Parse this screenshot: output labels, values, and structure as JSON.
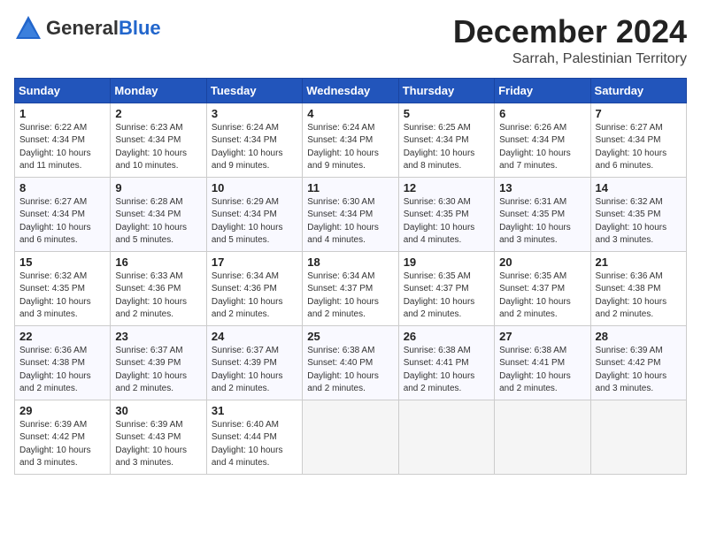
{
  "logo": {
    "general": "General",
    "blue": "Blue"
  },
  "title": "December 2024",
  "location": "Sarrah, Palestinian Territory",
  "days_of_week": [
    "Sunday",
    "Monday",
    "Tuesday",
    "Wednesday",
    "Thursday",
    "Friday",
    "Saturday"
  ],
  "weeks": [
    [
      {
        "day": "1",
        "sunrise": "6:22 AM",
        "sunset": "4:34 PM",
        "daylight": "10 hours and 11 minutes."
      },
      {
        "day": "2",
        "sunrise": "6:23 AM",
        "sunset": "4:34 PM",
        "daylight": "10 hours and 10 minutes."
      },
      {
        "day": "3",
        "sunrise": "6:24 AM",
        "sunset": "4:34 PM",
        "daylight": "10 hours and 9 minutes."
      },
      {
        "day": "4",
        "sunrise": "6:24 AM",
        "sunset": "4:34 PM",
        "daylight": "10 hours and 9 minutes."
      },
      {
        "day": "5",
        "sunrise": "6:25 AM",
        "sunset": "4:34 PM",
        "daylight": "10 hours and 8 minutes."
      },
      {
        "day": "6",
        "sunrise": "6:26 AM",
        "sunset": "4:34 PM",
        "daylight": "10 hours and 7 minutes."
      },
      {
        "day": "7",
        "sunrise": "6:27 AM",
        "sunset": "4:34 PM",
        "daylight": "10 hours and 6 minutes."
      }
    ],
    [
      {
        "day": "8",
        "sunrise": "6:27 AM",
        "sunset": "4:34 PM",
        "daylight": "10 hours and 6 minutes."
      },
      {
        "day": "9",
        "sunrise": "6:28 AM",
        "sunset": "4:34 PM",
        "daylight": "10 hours and 5 minutes."
      },
      {
        "day": "10",
        "sunrise": "6:29 AM",
        "sunset": "4:34 PM",
        "daylight": "10 hours and 5 minutes."
      },
      {
        "day": "11",
        "sunrise": "6:30 AM",
        "sunset": "4:34 PM",
        "daylight": "10 hours and 4 minutes."
      },
      {
        "day": "12",
        "sunrise": "6:30 AM",
        "sunset": "4:35 PM",
        "daylight": "10 hours and 4 minutes."
      },
      {
        "day": "13",
        "sunrise": "6:31 AM",
        "sunset": "4:35 PM",
        "daylight": "10 hours and 3 minutes."
      },
      {
        "day": "14",
        "sunrise": "6:32 AM",
        "sunset": "4:35 PM",
        "daylight": "10 hours and 3 minutes."
      }
    ],
    [
      {
        "day": "15",
        "sunrise": "6:32 AM",
        "sunset": "4:35 PM",
        "daylight": "10 hours and 3 minutes."
      },
      {
        "day": "16",
        "sunrise": "6:33 AM",
        "sunset": "4:36 PM",
        "daylight": "10 hours and 2 minutes."
      },
      {
        "day": "17",
        "sunrise": "6:34 AM",
        "sunset": "4:36 PM",
        "daylight": "10 hours and 2 minutes."
      },
      {
        "day": "18",
        "sunrise": "6:34 AM",
        "sunset": "4:37 PM",
        "daylight": "10 hours and 2 minutes."
      },
      {
        "day": "19",
        "sunrise": "6:35 AM",
        "sunset": "4:37 PM",
        "daylight": "10 hours and 2 minutes."
      },
      {
        "day": "20",
        "sunrise": "6:35 AM",
        "sunset": "4:37 PM",
        "daylight": "10 hours and 2 minutes."
      },
      {
        "day": "21",
        "sunrise": "6:36 AM",
        "sunset": "4:38 PM",
        "daylight": "10 hours and 2 minutes."
      }
    ],
    [
      {
        "day": "22",
        "sunrise": "6:36 AM",
        "sunset": "4:38 PM",
        "daylight": "10 hours and 2 minutes."
      },
      {
        "day": "23",
        "sunrise": "6:37 AM",
        "sunset": "4:39 PM",
        "daylight": "10 hours and 2 minutes."
      },
      {
        "day": "24",
        "sunrise": "6:37 AM",
        "sunset": "4:39 PM",
        "daylight": "10 hours and 2 minutes."
      },
      {
        "day": "25",
        "sunrise": "6:38 AM",
        "sunset": "4:40 PM",
        "daylight": "10 hours and 2 minutes."
      },
      {
        "day": "26",
        "sunrise": "6:38 AM",
        "sunset": "4:41 PM",
        "daylight": "10 hours and 2 minutes."
      },
      {
        "day": "27",
        "sunrise": "6:38 AM",
        "sunset": "4:41 PM",
        "daylight": "10 hours and 2 minutes."
      },
      {
        "day": "28",
        "sunrise": "6:39 AM",
        "sunset": "4:42 PM",
        "daylight": "10 hours and 3 minutes."
      }
    ],
    [
      {
        "day": "29",
        "sunrise": "6:39 AM",
        "sunset": "4:42 PM",
        "daylight": "10 hours and 3 minutes."
      },
      {
        "day": "30",
        "sunrise": "6:39 AM",
        "sunset": "4:43 PM",
        "daylight": "10 hours and 3 minutes."
      },
      {
        "day": "31",
        "sunrise": "6:40 AM",
        "sunset": "4:44 PM",
        "daylight": "10 hours and 4 minutes."
      },
      null,
      null,
      null,
      null
    ]
  ],
  "labels": {
    "sunrise": "Sunrise:",
    "sunset": "Sunset:",
    "daylight": "Daylight:"
  }
}
